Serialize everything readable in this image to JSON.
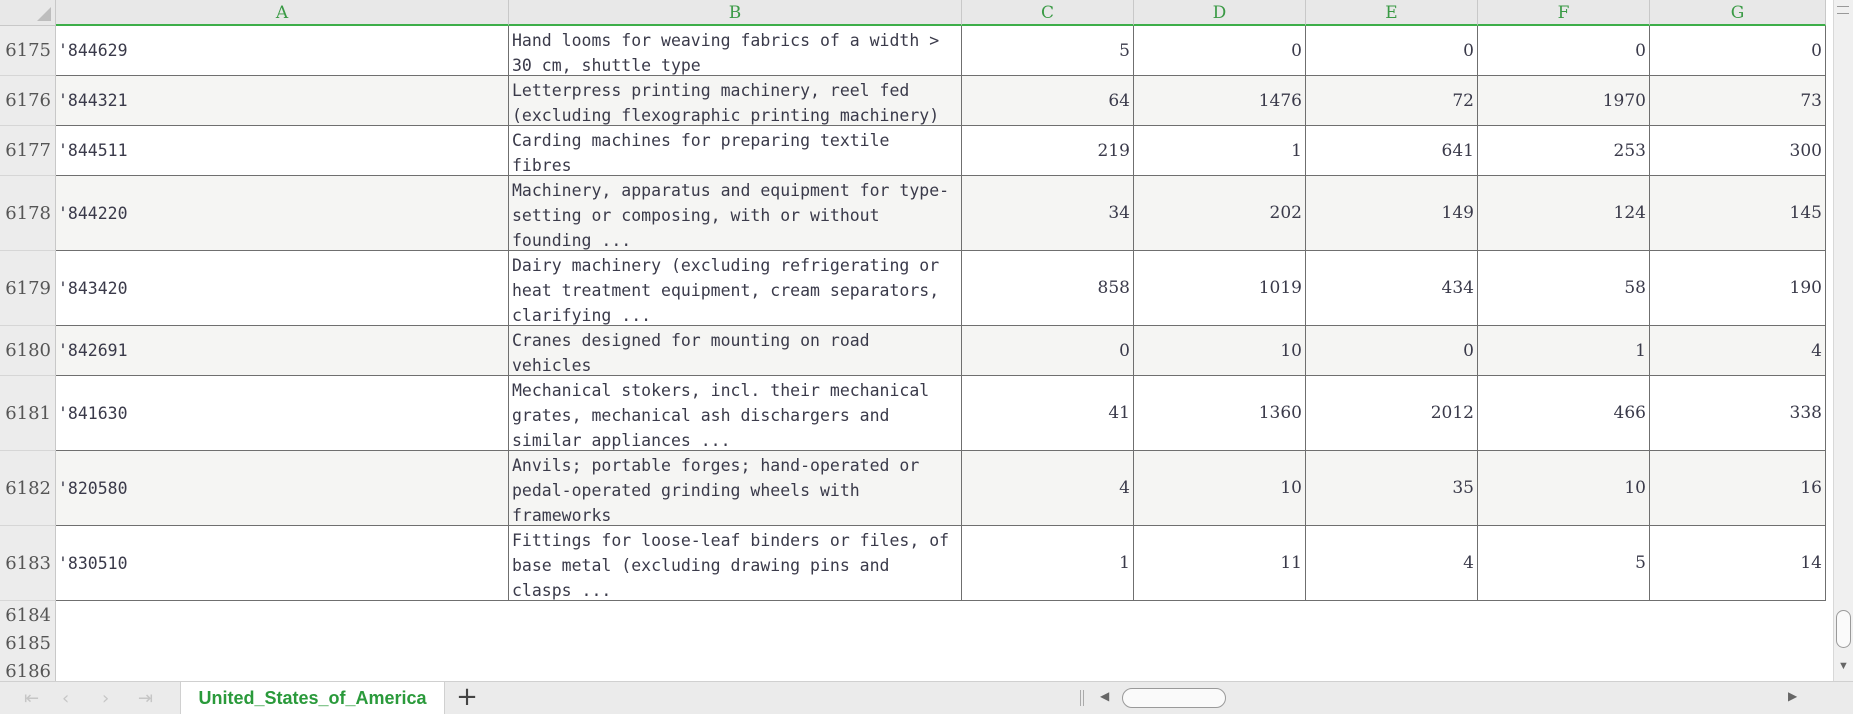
{
  "columns": [
    "A",
    "B",
    "C",
    "D",
    "E",
    "F",
    "G"
  ],
  "rows": [
    {
      "num": "6175",
      "a": "'844629",
      "b": "Hand looms for weaving fabrics of a width >\n30 cm, shuttle type",
      "c": "5",
      "d": "0",
      "e": "0",
      "f": "0",
      "g": "0"
    },
    {
      "num": "6176",
      "a": "'844321",
      "b": "Letterpress printing machinery, reel fed\n(excluding flexographic printing machinery)",
      "c": "64",
      "d": "1476",
      "e": "72",
      "f": "1970",
      "g": "73"
    },
    {
      "num": "6177",
      "a": "'844511",
      "b": "Carding machines for preparing textile\nfibres",
      "c": "219",
      "d": "1",
      "e": "641",
      "f": "253",
      "g": "300"
    },
    {
      "num": "6178",
      "a": "'844220",
      "b": "Machinery, apparatus and equipment for type-\nsetting or composing, with or without\nfounding ...",
      "c": "34",
      "d": "202",
      "e": "149",
      "f": "124",
      "g": "145"
    },
    {
      "num": "6179",
      "a": "'843420",
      "b": "Dairy machinery (excluding refrigerating or\nheat treatment equipment, cream separators,\nclarifying ...",
      "c": "858",
      "d": "1019",
      "e": "434",
      "f": "58",
      "g": "190"
    },
    {
      "num": "6180",
      "a": "'842691",
      "b": "Cranes designed for mounting on road\nvehicles",
      "c": "0",
      "d": "10",
      "e": "0",
      "f": "1",
      "g": "4"
    },
    {
      "num": "6181",
      "a": "'841630",
      "b": "Mechanical stokers, incl. their mechanical\ngrates, mechanical ash dischargers and\nsimilar appliances ...",
      "c": "41",
      "d": "1360",
      "e": "2012",
      "f": "466",
      "g": "338"
    },
    {
      "num": "6182",
      "a": "'820580",
      "b": "Anvils; portable forges; hand-operated or\npedal-operated grinding wheels with\nframeworks",
      "c": "4",
      "d": "10",
      "e": "35",
      "f": "10",
      "g": "16"
    },
    {
      "num": "6183",
      "a": "'830510",
      "b": "Fittings for loose-leaf binders or files, of\nbase metal (excluding drawing pins and\nclasps ...",
      "c": "1",
      "d": "11",
      "e": "4",
      "f": "5",
      "g": "14"
    }
  ],
  "empty_rows": [
    "6184",
    "6185",
    "6186"
  ],
  "sheet_tab": "United_States_of_America",
  "icons": {
    "nav_first": "first-sheet-icon",
    "nav_prev": "prev-sheet-icon",
    "nav_next": "next-sheet-icon",
    "nav_last": "last-sheet-icon",
    "add_sheet": "plus-icon"
  },
  "colors": {
    "accent": "#3dae49",
    "tab_text": "#2a9a3b"
  }
}
